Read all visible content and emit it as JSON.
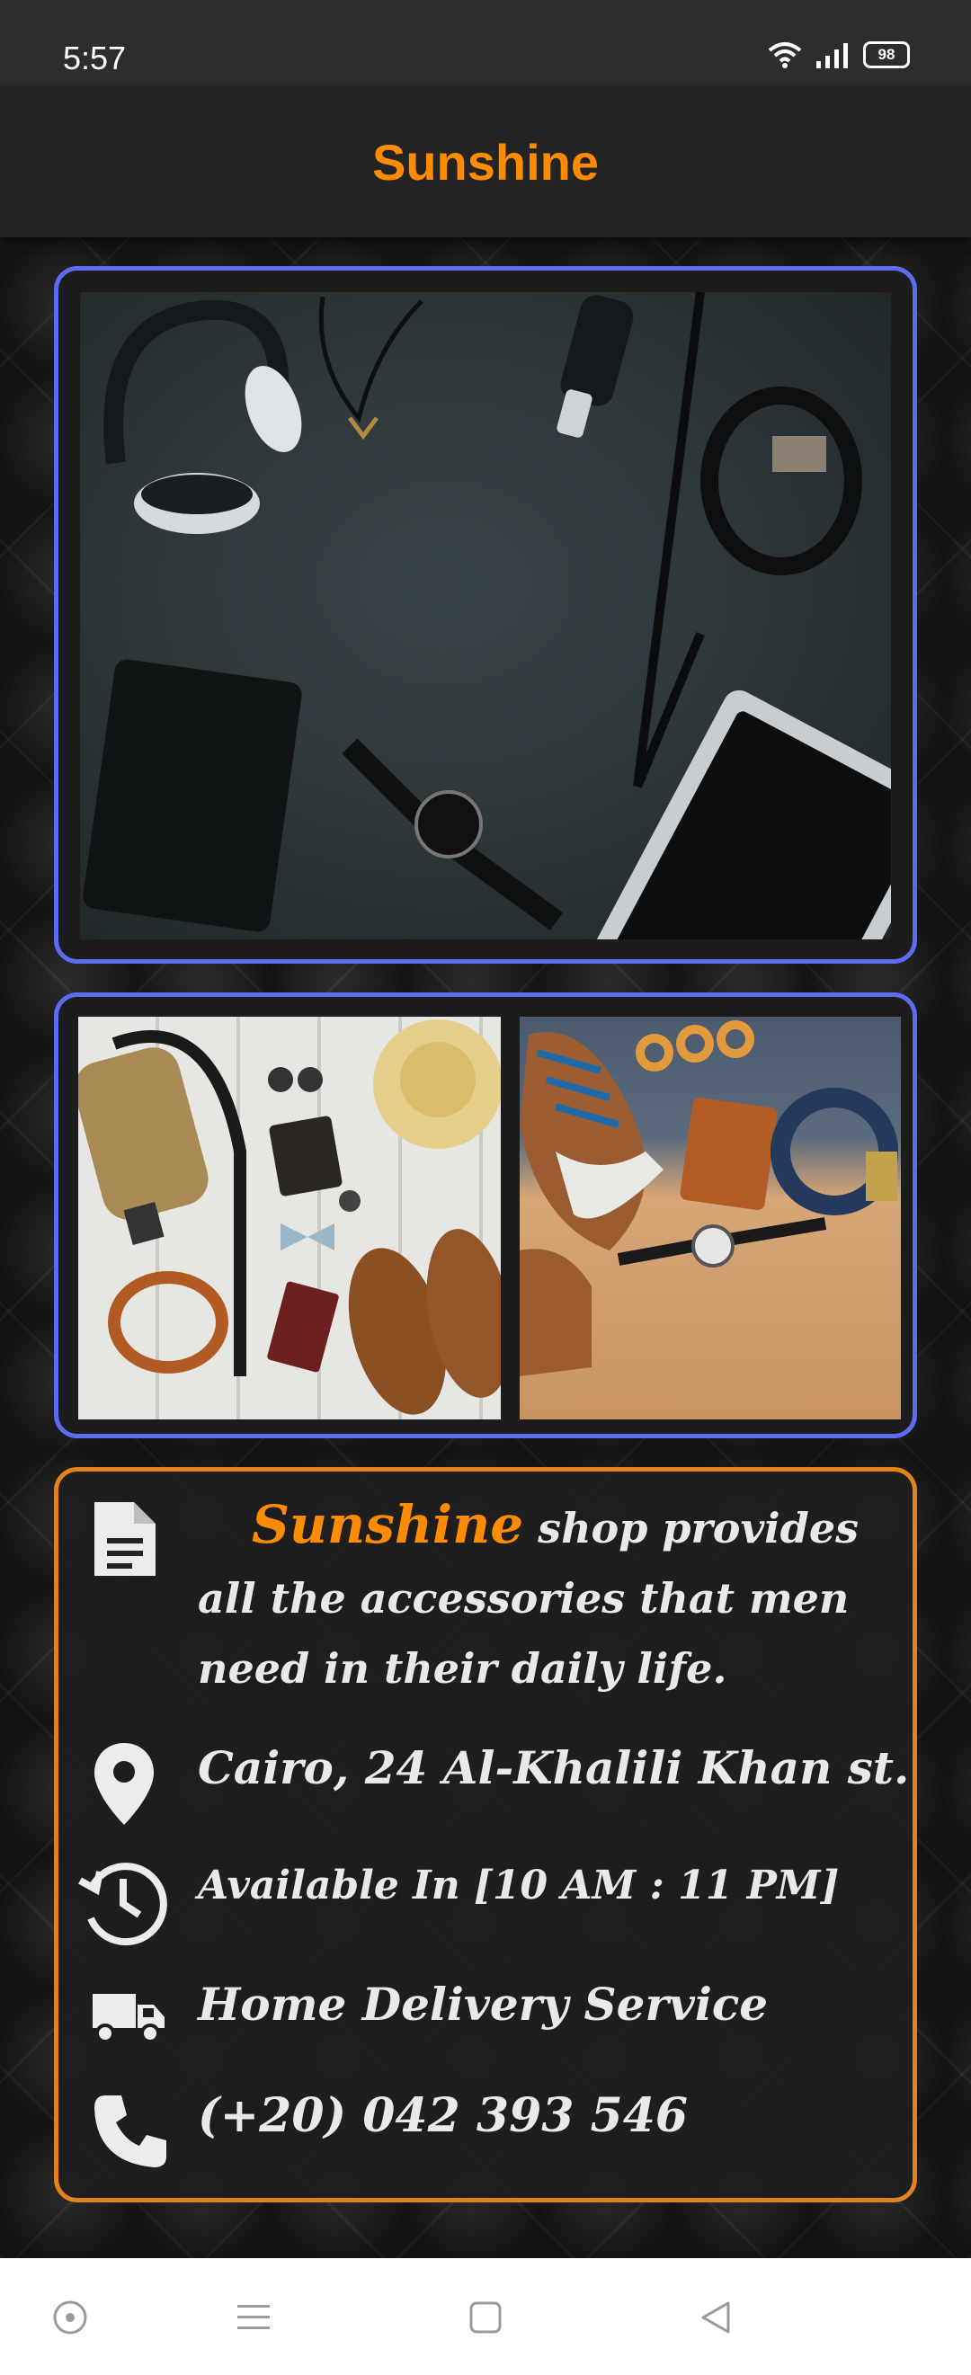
{
  "status_bar": {
    "time": "5:57",
    "battery": "98"
  },
  "app_bar": {
    "title": "Sunshine"
  },
  "info": {
    "brand": "Sunshine",
    "description_tail": "shop provides all the accessories that men need in their daily life.",
    "address": "Cairo, 24 Al-Khalili Khan st.",
    "hours": "Available In [10 AM : 11 PM]",
    "delivery": "Home Delivery Service",
    "phone": "(+20) 042 393 546"
  },
  "icons": {
    "description": "document-icon",
    "address": "location-pin-icon",
    "hours": "clock-history-icon",
    "delivery": "truck-icon",
    "phone": "phone-icon"
  },
  "colors": {
    "accent": "#ff8c00",
    "hero_border": "#5b6bf2",
    "info_border": "#e0821e"
  }
}
